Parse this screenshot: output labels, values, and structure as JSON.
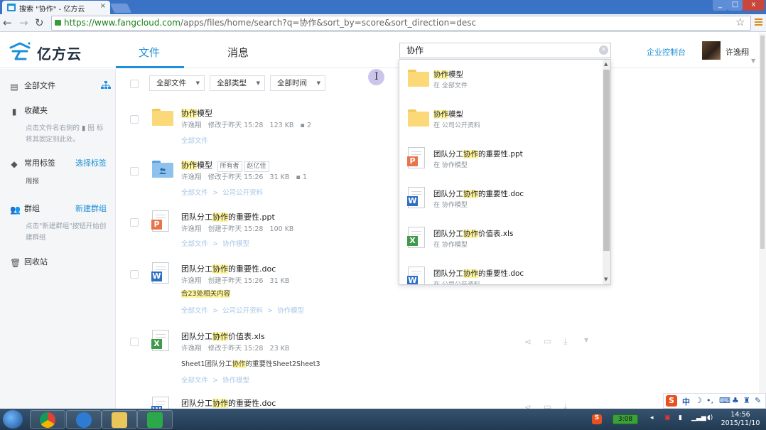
{
  "browser": {
    "tab_title": "搜索 \"协作\" - 亿方云",
    "tab_close": "×",
    "url_host": "https://www.fangcloud.com",
    "url_rest": "/apps/files/home/search?q=协作&sort_by=score&sort_direction=desc",
    "win_min": "_",
    "win_max": "□",
    "win_close": "x"
  },
  "header": {
    "logo_text": "亿方云",
    "nav_files": "文件",
    "nav_messages": "消息",
    "search_value": "协作",
    "console_link": "企业控制台",
    "username": "许逸翔"
  },
  "sidebar": {
    "all_files": "全部文件",
    "favorites": "收藏夹",
    "favorites_hint_a": "点击文件名右侧的",
    "favorites_hint_b": "图",
    "favorites_hint_c": "标将其固定到此处。",
    "tags": "常用标签",
    "choose_tags": "选择标签",
    "tag_item": "周报",
    "groups": "群组",
    "new_group": "新建群组",
    "groups_hint": "点击\"新建群组\"按钮开始创建群组",
    "trash": "回收站"
  },
  "filters": {
    "all_files": "全部文件",
    "all_types": "全部类型",
    "all_time": "全部时间"
  },
  "results": [
    {
      "name_pre": "",
      "name_hl": "协作",
      "name_post": "模型",
      "owner": "许逸翔",
      "action": "修改于昨天 15:28",
      "size": "123 KB",
      "count": "2",
      "path": [
        "全部文件"
      ]
    },
    {
      "name_pre": "",
      "name_hl": "协作",
      "name_post": "模型",
      "tag_owner": "所有者",
      "tag_owner_name": "赵亿佳",
      "owner": "许逸翔",
      "action": "修改于昨天 15:26",
      "size": "31 KB",
      "count": "1",
      "path": [
        "全部文件",
        ">",
        "公司公开资料"
      ]
    },
    {
      "name_pre": "团队分工",
      "name_hl": "协作",
      "name_post": "的重要性.ppt",
      "owner": "许逸翔",
      "action": "创建于昨天 15:28",
      "size": "100 KB",
      "path": [
        "全部文件",
        ">",
        "协作模型"
      ]
    },
    {
      "name_pre": "团队分工",
      "name_hl": "协作",
      "name_post": "的重要性.doc",
      "owner": "许逸翔",
      "action": "创建于昨天 15:26",
      "size": "31 KB",
      "extra": "合23处相关内容",
      "path": [
        "全部文件",
        ">",
        "公司公开资料",
        ">",
        "协作模型"
      ]
    },
    {
      "name_pre": "团队分工",
      "name_hl": "协作",
      "name_post": "价值表.xls",
      "owner": "许逸翔",
      "action": "修改于昨天 15:28",
      "size": "23 KB",
      "extra_pre": "Sheet1团队分工",
      "extra_hl": "协作",
      "extra_post": "的重要性Sheet2Sheet3",
      "path": [
        "全部文件",
        ">",
        "协作模型"
      ]
    },
    {
      "name_pre": "团队分工",
      "name_hl": "协作",
      "name_post": "的重要性.doc"
    }
  ],
  "dropdown": [
    {
      "name_pre": "",
      "name_hl": "协作",
      "name_post": "模型",
      "loc": "在 全部文件",
      "icon": "folder-icon"
    },
    {
      "name_pre": "",
      "name_hl": "协作",
      "name_post": "模型",
      "loc": "在 公司公开资料",
      "icon": "folder-icon"
    },
    {
      "name_pre": "团队分工",
      "name_hl": "协作",
      "name_post": "的重要性.ppt",
      "loc": "在 协作模型",
      "icon": "ppt-icon"
    },
    {
      "name_pre": "团队分工",
      "name_hl": "协作",
      "name_post": "的重要性.doc",
      "loc": "在 协作模型",
      "icon": "word-icon"
    },
    {
      "name_pre": "团队分工",
      "name_hl": "协作",
      "name_post": "价值表.xls",
      "loc": "在 协作模型",
      "icon": "excel-icon"
    },
    {
      "name_pre": "团队分工",
      "name_hl": "协作",
      "name_post": "的重要性.doc",
      "loc": "在 公司公开资料",
      "icon": "word-icon"
    }
  ],
  "taskbar": {
    "battery": "3:08",
    "time": "14:56",
    "date": "2015/11/10",
    "ime_label": "中"
  },
  "colors": {
    "accent": "#1e8fd8",
    "highlight": "#fff59d",
    "titlebar": "#3a73c6"
  }
}
